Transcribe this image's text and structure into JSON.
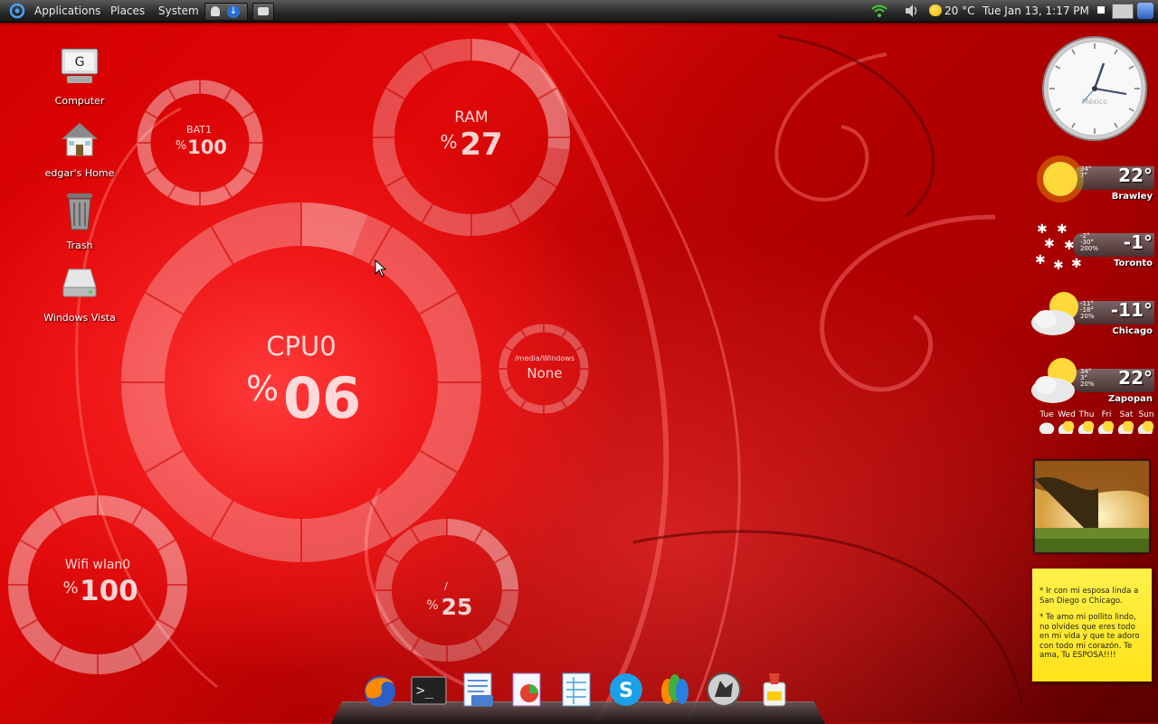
{
  "panel": {
    "menus": [
      "Applications",
      "Places",
      "System"
    ],
    "weather_temp": "20 °C",
    "datetime": "Tue Jan 13,  1:17 PM"
  },
  "desktop_icons": [
    {
      "label": "Computer",
      "icon": "computer-icon"
    },
    {
      "label": "edgar's Home",
      "icon": "home-folder-icon"
    },
    {
      "label": "Trash",
      "icon": "trash-icon"
    },
    {
      "label": "Windows Vista",
      "icon": "drive-icon"
    }
  ],
  "gauges": {
    "cpu": {
      "label": "CPU0",
      "pct": "%",
      "value": "06",
      "level": 0.06
    },
    "ram": {
      "label": "RAM",
      "pct": "%",
      "value": "27",
      "level": 0.27
    },
    "bat": {
      "label": "BAT1",
      "pct": "%",
      "value": "100",
      "level": 1.0
    },
    "wifi": {
      "label": "Wifi wlan0",
      "pct": "%",
      "value": "100",
      "level": 1.0
    },
    "root": {
      "label": "/",
      "pct": "%",
      "value": "25",
      "level": 0.25
    },
    "win": {
      "label": "/media/Windows",
      "value": "None"
    }
  },
  "clock": {
    "face_text": "México"
  },
  "weather": [
    {
      "city": "Brawley",
      "temp": "22°",
      "details": [
        "34°",
        "7°"
      ],
      "icon": "sunny-icon"
    },
    {
      "city": "Toronto",
      "temp": "-1°",
      "details": [
        "-2°",
        "-30°",
        "200%"
      ],
      "icon": "snow-icon"
    },
    {
      "city": "Chicago",
      "temp": "-11°",
      "details": [
        "-11°",
        "-18°",
        "20%"
      ],
      "icon": "partly-cloudy-icon"
    },
    {
      "city": "Zapopan",
      "temp": "22°",
      "details": [
        "34°",
        "3°",
        "20%"
      ],
      "icon": "partly-cloudy-icon"
    }
  ],
  "forecast_days": [
    "Tue",
    "Wed",
    "Thu",
    "Fri",
    "Sat",
    "Sun"
  ],
  "note": {
    "lines": [
      "* Ir con mi esposa linda a San Diego o Chicago.",
      "* Te amo mi pollito lindo, no olvides que eres todo en mi vida y que te adoro con todo mi corazón. Te ama, Tu ESPOSA!!!!"
    ]
  },
  "dock": [
    "firefox-icon",
    "terminal-icon",
    "writer-icon",
    "impress-icon",
    "calc-icon",
    "skype-icon",
    "messenger-icon",
    "wolf-app-icon",
    "paint-icon"
  ],
  "colors": {
    "accent": "#e00808",
    "panel": "#2b2b2b",
    "note": "#fff14a"
  }
}
